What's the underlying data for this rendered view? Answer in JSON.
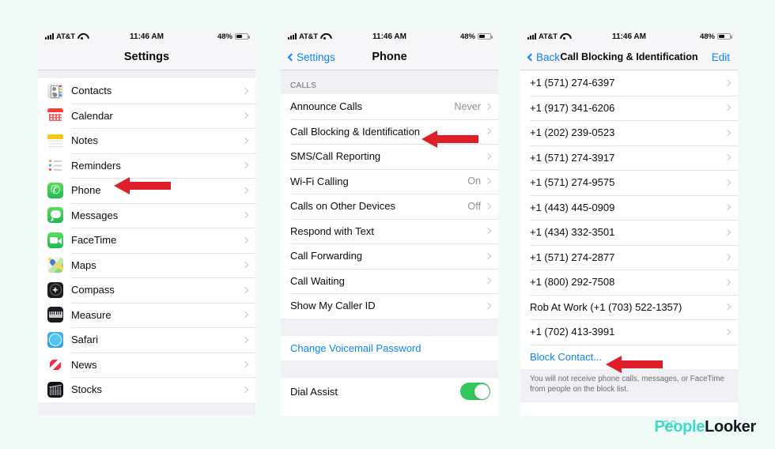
{
  "background_color": "#eefbf6",
  "accent_blue": "#0a84ff",
  "arrow_color": "#e01e2a",
  "toggle_on_color": "#34c759",
  "status_bar": {
    "carrier": "AT&T",
    "time": "11:46 AM",
    "battery_percent": "48%",
    "signal_icon": "signal-bars-icon",
    "wifi_icon": "wifi-icon",
    "battery_icon": "battery-icon"
  },
  "panel_settings": {
    "title": "Settings",
    "items": [
      {
        "label": "Contacts",
        "icon": "contacts-app-icon"
      },
      {
        "label": "Calendar",
        "icon": "calendar-app-icon"
      },
      {
        "label": "Notes",
        "icon": "notes-app-icon"
      },
      {
        "label": "Reminders",
        "icon": "reminders-app-icon"
      },
      {
        "label": "Phone",
        "icon": "phone-app-icon"
      },
      {
        "label": "Messages",
        "icon": "messages-app-icon"
      },
      {
        "label": "FaceTime",
        "icon": "facetime-app-icon"
      },
      {
        "label": "Maps",
        "icon": "maps-app-icon"
      },
      {
        "label": "Compass",
        "icon": "compass-app-icon"
      },
      {
        "label": "Measure",
        "icon": "measure-app-icon"
      },
      {
        "label": "Safari",
        "icon": "safari-app-icon"
      },
      {
        "label": "News",
        "icon": "news-app-icon"
      },
      {
        "label": "Stocks",
        "icon": "stocks-app-icon"
      }
    ]
  },
  "panel_phone": {
    "back_label": "Settings",
    "title": "Phone",
    "section_header": "CALLS",
    "items": [
      {
        "label": "Announce Calls",
        "value": "Never"
      },
      {
        "label": "Call Blocking & Identification",
        "value": ""
      },
      {
        "label": "SMS/Call Reporting",
        "value": ""
      },
      {
        "label": "Wi-Fi Calling",
        "value": "On"
      },
      {
        "label": "Calls on Other Devices",
        "value": "Off"
      },
      {
        "label": "Respond with Text",
        "value": ""
      },
      {
        "label": "Call Forwarding",
        "value": ""
      },
      {
        "label": "Call Waiting",
        "value": ""
      },
      {
        "label": "Show My Caller ID",
        "value": ""
      }
    ],
    "voicemail_link": "Change Voicemail Password",
    "dial_assist_label": "Dial Assist",
    "dial_assist_state": "on"
  },
  "panel_block": {
    "back_label": "Back",
    "title": "Call Blocking & Identification",
    "edit_label": "Edit",
    "blocked_numbers": [
      "+1 (571) 274-6397",
      "+1 (917) 341-6206",
      "+1 (202) 239-0523",
      "+1 (571) 274-3917",
      "+1 (571) 274-9575",
      "+1 (443) 445-0909",
      "+1 (434) 332-3501",
      "+1 (571) 274-2877",
      "+1 (800) 292-7508",
      "Rob At Work (+1 (703) 522-1357)",
      "+1 (702) 413-3991"
    ],
    "block_contact_label": "Block Contact...",
    "footnote": "You will not receive phone calls, messages, or FaceTime from people on the block list."
  },
  "annotations": {
    "arrow_phone_row": "arrow pointing left at Phone row",
    "arrow_call_blocking_row": "arrow pointing left at Call Blocking & Identification row",
    "arrow_block_contact": "arrow pointing left at Block Contact link"
  },
  "logo": {
    "part1": "People",
    "part2": "Looker"
  }
}
